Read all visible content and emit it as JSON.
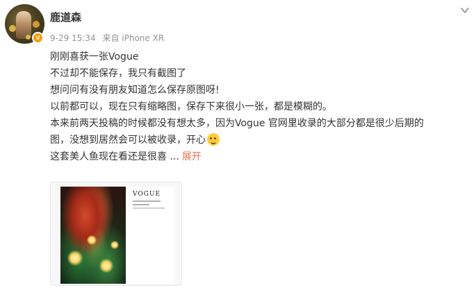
{
  "post": {
    "username": "鹿道森",
    "meta": {
      "time": "9-29 15:34",
      "source": "来自 iPhone XR"
    },
    "content_lines": [
      "刚刚喜获一张Vogue",
      "不过却不能保存，我只有截图了",
      "想问问有没有朋友知道怎么保存原图呀!",
      "以前都可以，现在只有缩略图，保存下来很小一张，都是模糊的。",
      "本来前两天投稿的时候都没有想太多，因为Vogue 官网里收录的大部分都是很少后期的",
      "图，没想到居然会可以被收录，开心",
      "这套美人鱼现在看还是很喜  ..."
    ],
    "expand_label": "展开",
    "image": {
      "magazine_word": "VOGUE"
    }
  },
  "icons": {
    "dropdown": "chevron-down-icon",
    "verified": "verified-badge-icon",
    "emoji": "happy-emoji-icon"
  },
  "colors": {
    "text": "#333333",
    "meta": "#939393",
    "link": "#eb7350",
    "badge": "#f59e0b"
  }
}
